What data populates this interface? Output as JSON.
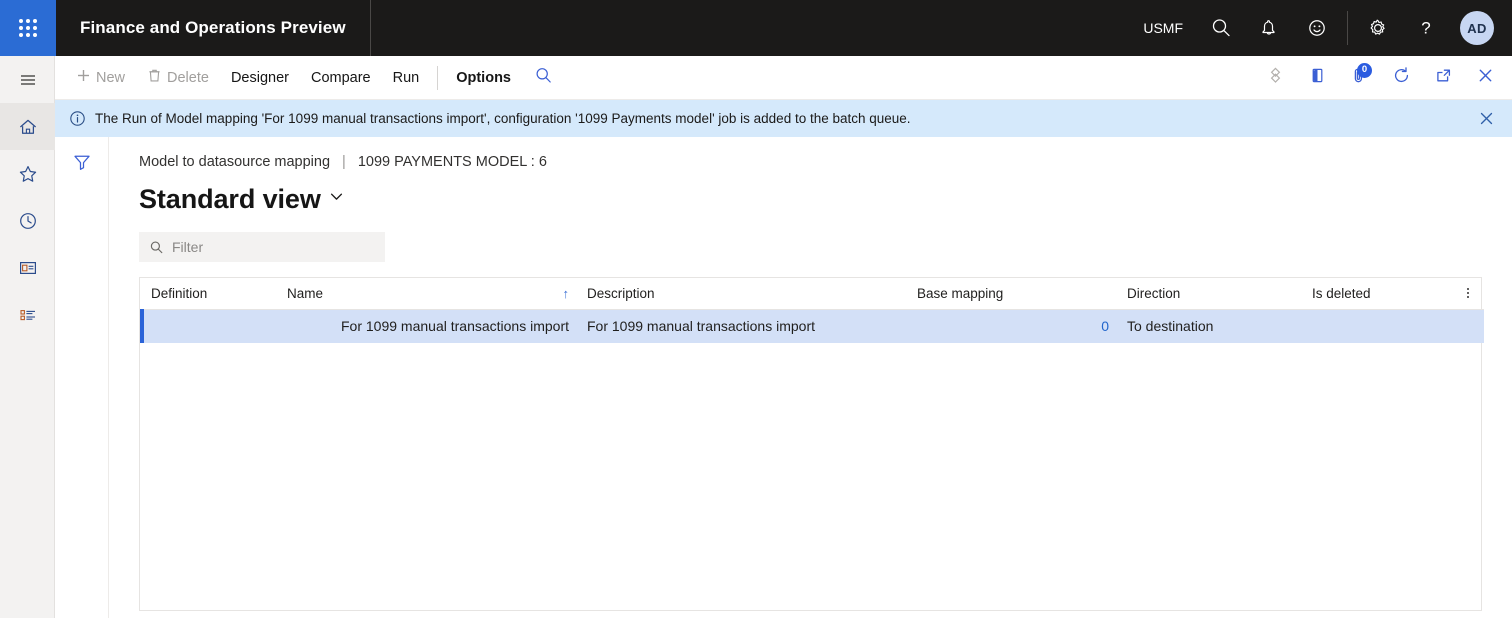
{
  "topbar": {
    "app_title": "Finance and Operations Preview",
    "company": "USMF",
    "icons": {
      "waffle": "app-launcher-icon",
      "search": "search-icon",
      "notifications": "bell-icon",
      "feedback": "smiley-icon",
      "settings": "gear-icon",
      "help": "question-mark-icon"
    },
    "avatar_initials": "AD"
  },
  "rail": {
    "items": [
      {
        "name": "navigation-menu",
        "icon": "hamburger-icon"
      },
      {
        "name": "home",
        "icon": "home-icon",
        "active": true
      },
      {
        "name": "favorites",
        "icon": "star-icon"
      },
      {
        "name": "recent",
        "icon": "clock-icon"
      },
      {
        "name": "workspaces",
        "icon": "workspace-icon"
      },
      {
        "name": "modules",
        "icon": "list-icon"
      }
    ]
  },
  "actionpane": {
    "buttons": [
      {
        "label": "New",
        "icon": "plus-icon",
        "disabled": true
      },
      {
        "label": "Delete",
        "icon": "trash-icon",
        "disabled": true
      },
      {
        "label": "Designer",
        "disabled": false
      },
      {
        "label": "Compare",
        "disabled": false
      },
      {
        "label": "Run",
        "disabled": false
      }
    ],
    "options_label": "Options",
    "search_icon": "search-icon",
    "right_icons": [
      {
        "name": "personalize-icon",
        "badge": null
      },
      {
        "name": "office-export-icon",
        "badge": null
      },
      {
        "name": "attachments-icon",
        "badge": "0"
      },
      {
        "name": "refresh-icon",
        "badge": null
      },
      {
        "name": "open-in-new-window-icon",
        "badge": null
      },
      {
        "name": "close-icon",
        "badge": null
      }
    ]
  },
  "message_bar": {
    "icon": "info-icon",
    "text": "The Run of Model mapping 'For 1099 manual transactions import', configuration '1099 Payments model' job is added to the batch queue.",
    "close_icon": "close-icon",
    "background": "#d5e9fb"
  },
  "filter_rail": {
    "filter_icon": "funnel-filter-icon"
  },
  "page": {
    "breadcrumb_main": "Model to datasource mapping",
    "breadcrumb_separator": "|",
    "breadcrumb_sub": "1099 PAYMENTS MODEL : 6",
    "title": "Standard view",
    "title_chevron": "chevron-down-icon"
  },
  "filter": {
    "icon": "search-icon",
    "placeholder": "Filter",
    "value": ""
  },
  "grid": {
    "columns": [
      {
        "label": "Definition",
        "align": "left",
        "sorted": false
      },
      {
        "label": "Name",
        "align": "left",
        "sorted": true,
        "sort_dir": "↑"
      },
      {
        "label": "Description",
        "align": "left",
        "sorted": false
      },
      {
        "label": "Base mapping",
        "align": "left",
        "sorted": false
      },
      {
        "label": "Direction",
        "align": "left",
        "sorted": false
      },
      {
        "label": "Is deleted",
        "align": "left",
        "sorted": false
      }
    ],
    "kebab_icon": "more-options-icon",
    "rows": [
      {
        "definition": "",
        "name": "For 1099 manual transactions import",
        "description": "For 1099 manual transactions import",
        "base_mapping": "0",
        "direction": "To destination",
        "is_deleted": "",
        "selected": true
      }
    ]
  },
  "colors": {
    "brand_blue": "#2b6cd4",
    "topbar_bg": "#1b1a19",
    "selected_row": "#d3e0f7",
    "row_accent": "#2a63d8",
    "link": "#2266cc",
    "info_bar": "#d5e9fb"
  }
}
